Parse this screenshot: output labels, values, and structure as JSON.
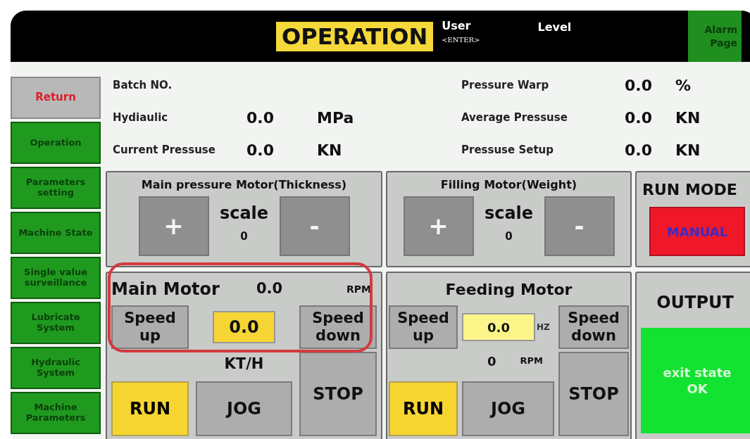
{
  "header": {
    "title": "OPERATION",
    "user_label": "User",
    "user_value": "<ENTER>",
    "level_label": "Level",
    "alarm_button": "Alarm Page"
  },
  "sidebar": [
    {
      "label": "Return",
      "kind": "return"
    },
    {
      "label": "Operation",
      "kind": "nav"
    },
    {
      "label": "Parameters setting",
      "kind": "nav"
    },
    {
      "label": "Machine State",
      "kind": "nav"
    },
    {
      "label": "Single value surveillance",
      "kind": "nav"
    },
    {
      "label": "Lubricate System",
      "kind": "nav"
    },
    {
      "label": "Hydraulic System",
      "kind": "nav"
    },
    {
      "label": "Machine Parameters",
      "kind": "nav"
    }
  ],
  "readings_left": [
    {
      "label": "Batch NO."
    },
    {
      "label": "Hydiaulic",
      "value": "0.0",
      "unit": "MPa"
    },
    {
      "label": "Current Pressuse",
      "value": "0.0",
      "unit": "KN"
    }
  ],
  "readings_right": [
    {
      "label": "Pressure Warp",
      "value": "0.0",
      "unit": "%"
    },
    {
      "label": "Average Pressuse",
      "value": "0.0",
      "unit": "KN"
    },
    {
      "label": "Pressuse Setup",
      "value": "0.0",
      "unit": "KN"
    }
  ],
  "scale_panels": [
    {
      "title": "Main pressure Motor(Thickness)",
      "plus": "+",
      "scale_label": "scale",
      "scale_value": "0",
      "minus": "-"
    },
    {
      "title": "Filling Motor(Weight)",
      "plus": "+",
      "scale_label": "scale",
      "scale_value": "0",
      "minus": "-"
    }
  ],
  "run_mode": {
    "title": "RUN MODE",
    "button": "MANUAL"
  },
  "main_motor": {
    "title": "Main Motor",
    "rpm": "0.0",
    "rpm_unit": "RPM",
    "speed_up": "Speed up",
    "value": "0.0",
    "speed_down": "Speed down",
    "unit": "KT/H",
    "run": "RUN",
    "jog": "JOG",
    "stop": "STOP"
  },
  "feeding_motor": {
    "title": "Feeding Motor",
    "speed_up": "Speed up",
    "value": "0.0",
    "value_unit": "HZ",
    "speed_down": "Speed down",
    "rpm": "0",
    "rpm_unit": "RPM",
    "run": "RUN",
    "jog": "JOG",
    "stop": "STOP"
  },
  "output": {
    "title": "OUTPUT",
    "status": "exit state OK"
  }
}
